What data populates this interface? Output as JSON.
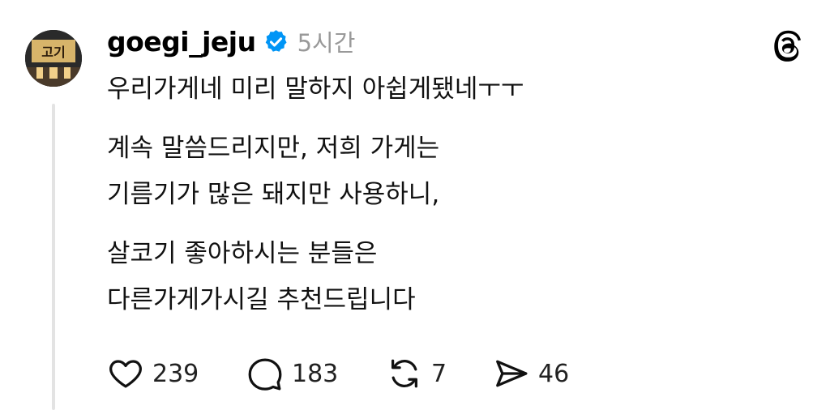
{
  "post": {
    "username": "goegi_jeju",
    "timestamp": "5시간",
    "avatar_text": "고기",
    "lines": [
      "우리가게네 미리 말하지 아쉽게됐네ㅜㅜ",
      "계속 말씀드리지만, 저희 가게는",
      "기름기가 많은 돼지만 사용하니,",
      "살코기 좋아하시는 분들은",
      "다른가게가시길 추천드립니다"
    ]
  },
  "actions": {
    "likes": "239",
    "replies": "183",
    "reposts": "7",
    "shares": "46"
  },
  "colors": {
    "verified": "#0095f6",
    "timestamp": "#999999",
    "thread_line": "#e3e3e3"
  },
  "icons": {
    "verified": "verified-badge-icon",
    "app": "threads-logo-icon",
    "like": "heart-icon",
    "reply": "comment-icon",
    "repost": "repost-icon",
    "share": "send-icon"
  }
}
